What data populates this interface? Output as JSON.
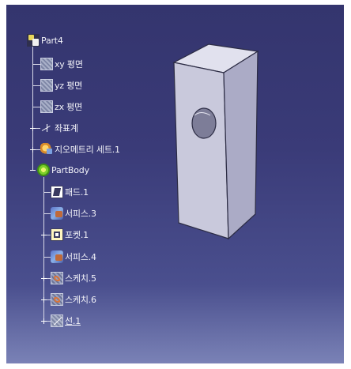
{
  "tree": {
    "root": {
      "label": "Part4",
      "icon": "part-icon"
    },
    "items": [
      {
        "label": "xy 평면",
        "icon": "plane-icon"
      },
      {
        "label": "yz 평면",
        "icon": "plane-icon"
      },
      {
        "label": "zx 평면",
        "icon": "plane-icon"
      },
      {
        "label": "좌표계",
        "icon": "axis-system-icon"
      },
      {
        "label": "지오메트리 세트.1",
        "icon": "geometrical-set-icon"
      },
      {
        "label": "PartBody",
        "icon": "part-body-icon"
      }
    ],
    "body_items": [
      {
        "label": "패드.1",
        "icon": "pad-icon"
      },
      {
        "label": "서피스.3",
        "icon": "surface-icon"
      },
      {
        "label": "포켓.1",
        "icon": "pocket-icon"
      },
      {
        "label": "서피스.4",
        "icon": "surface-icon"
      },
      {
        "label": "스케치.5",
        "icon": "sketch-icon"
      },
      {
        "label": "스케치.6",
        "icon": "sketch-icon"
      },
      {
        "label": "선.1",
        "icon": "line-icon"
      }
    ]
  },
  "model": {
    "description_icon": "rectangular-block-with-hole",
    "colors": {
      "top": "#e1e1ee",
      "left": "#c9c9dc",
      "front": "#ababc6",
      "edge": "#2c2c44",
      "hole": "#7d7d98"
    }
  },
  "colors": {
    "background_top": "#34356e",
    "background_bottom": "#7a82b6",
    "tree_text": "#f2f2f8"
  }
}
